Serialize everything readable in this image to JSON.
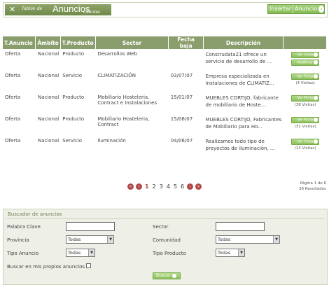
{
  "header": {
    "logo_line1": "Tablón de",
    "logo_line2": "Anuncios",
    "logo_line3": "Clientes",
    "insert_label": "Insertar",
    "insert_label2": "Anuncio"
  },
  "table": {
    "columns": [
      "T.Anuncio",
      "Ámbito",
      "T.Producto",
      "Sector",
      "Fecha baja",
      "Descripción",
      ""
    ],
    "rows": [
      {
        "tipo": "Oferta",
        "ambito": "Nacional",
        "producto": "Producto",
        "sector": "Desarrollos Web",
        "fecha": "",
        "desc": "Construdata21 ofrece un servicio de desarrollo de ...",
        "ver": "Ver Ficha",
        "extra": "Modificar",
        "visitas": ""
      },
      {
        "tipo": "Oferta",
        "ambito": "Nacional",
        "producto": "Servicio",
        "sector": "CLIMATIZACIÓN",
        "fecha": "03/07/07",
        "desc": "Empresa especializada en Instalaciones de CLIMATIZ...",
        "ver": "Ver Ficha",
        "extra": "",
        "visitas": "(4 Visitas)"
      },
      {
        "tipo": "Oferta",
        "ambito": "Nacional",
        "producto": "Producto",
        "sector": "Mobiliario Hosteleria, Contract e Instalaciones",
        "fecha": "15/01/07",
        "desc": "MUEBLES CORTIJO, fabricante de mobiliario de Hoste...",
        "ver": "Ver Ficha",
        "extra": "",
        "visitas": "(38 Visitas)"
      },
      {
        "tipo": "Oferta",
        "ambito": "Nacional",
        "producto": "Producto",
        "sector": "Mobiliario Hosteleria, Contract",
        "fecha": "15/06/07",
        "desc": "MUEBLES CORTIJO, Fabricantes de Mobiliario para Ho...",
        "ver": "Ver Ficha",
        "extra": "",
        "visitas": "(31 Visitas)"
      },
      {
        "tipo": "Oferta",
        "ambito": "Nacional",
        "producto": "Servicio",
        "sector": "Iluminación",
        "fecha": "04/06/07",
        "desc": "Realizamos todo tipo de proyectos de iluminación, ...",
        "ver": "Ver Ficha",
        "extra": "",
        "visitas": "(13 Visitas)"
      }
    ]
  },
  "pager": {
    "pages": [
      "1",
      "2",
      "3",
      "4",
      "5",
      "6"
    ],
    "info_line1": "Página 1 de 6",
    "info_line2": "26 Resultados"
  },
  "search": {
    "title": "Buscador de anuncios",
    "palabra_label": "Palabra Clave",
    "sector_label": "Sector",
    "provincia_label": "Provincia",
    "provincia_value": "Todas",
    "comunidad_label": "Comunidad",
    "comunidad_value": "Todas",
    "tipo_anuncio_label": "Tipo Anuncio",
    "tipo_anuncio_value": "Todas",
    "tipo_producto_label": "Tipo Producto",
    "tipo_producto_value": "Todas",
    "propios_label": "Buscar en mis propios anuncios",
    "buscar_label": "Buscar"
  }
}
